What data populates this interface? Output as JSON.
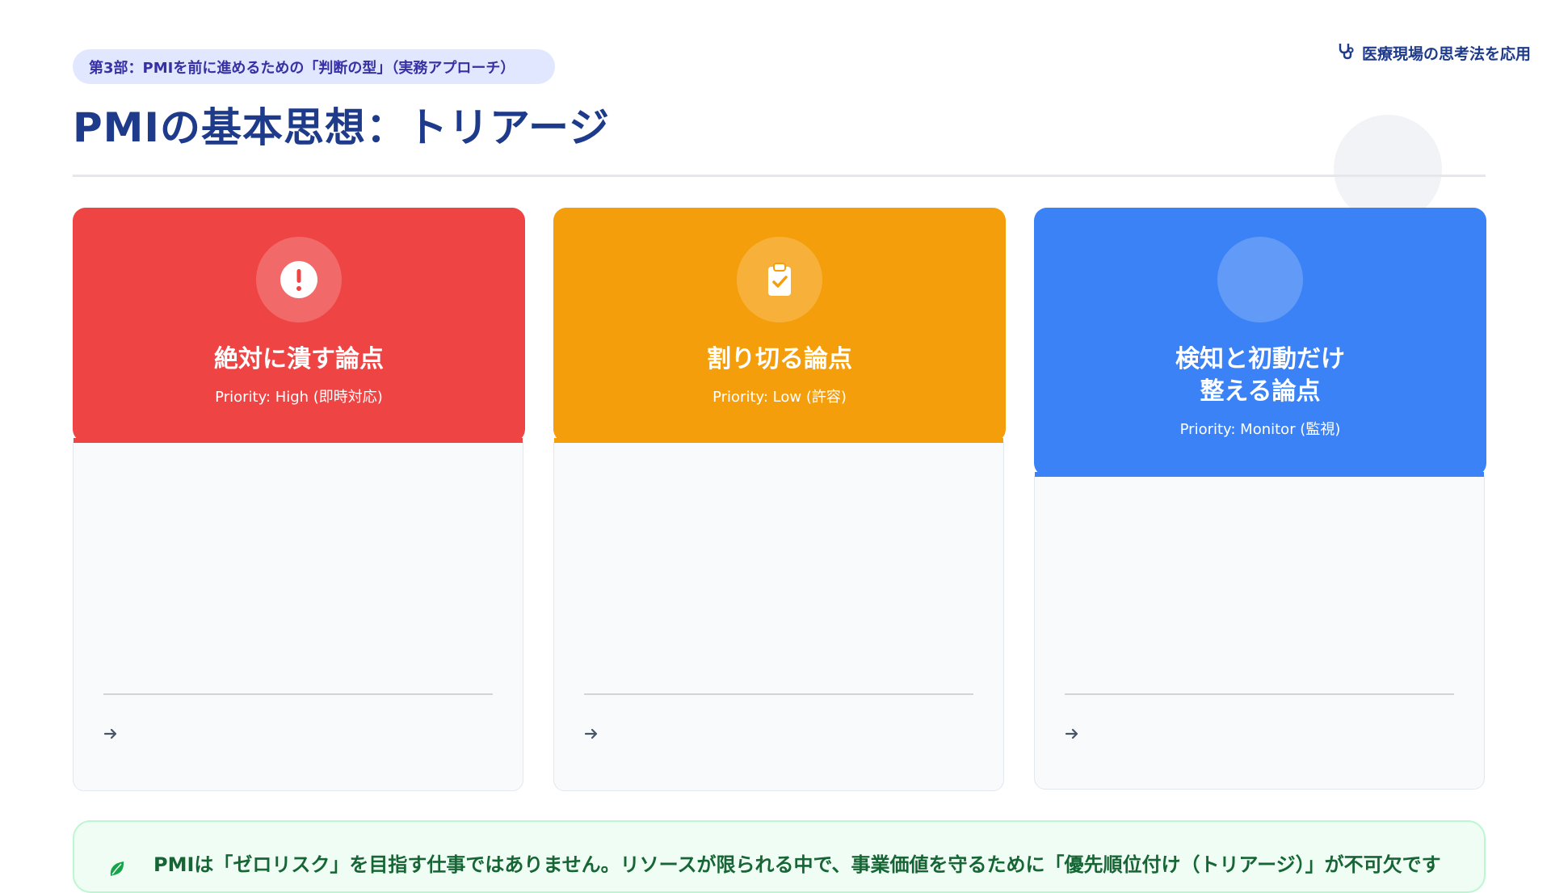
{
  "header": {
    "section_label": "第3部：PMIを前に進めるための「判断の型」（実務アプローチ）",
    "title": "PMIの基本思想：トリアージ",
    "note": "医療現場の思考法を応用",
    "note_icon": "stethoscope-icon"
  },
  "cards": [
    {
      "title_lines": [
        "絶対に潰す論点"
      ],
      "priority": "Priority: High (即時対応)",
      "icon": "exclamation-icon",
      "color": "#ef4444"
    },
    {
      "title_lines": [
        "割り切る論点"
      ],
      "priority": "Priority: Low (許容)",
      "icon": "clipboard-check-icon",
      "color": "#f59e0b"
    },
    {
      "title_lines": [
        "検知と初動だけ",
        "整える論点"
      ],
      "priority": "Priority: Monitor (監視)",
      "icon": "",
      "color": "#3b82f6"
    }
  ],
  "footer": {
    "message": "PMIは「ゼロリスク」を目指す仕事ではありません。リソースが限られる中で、事業価値を守るために「優先順位付け（トリアージ）」が不可欠です",
    "icon": "leaf-icon"
  }
}
